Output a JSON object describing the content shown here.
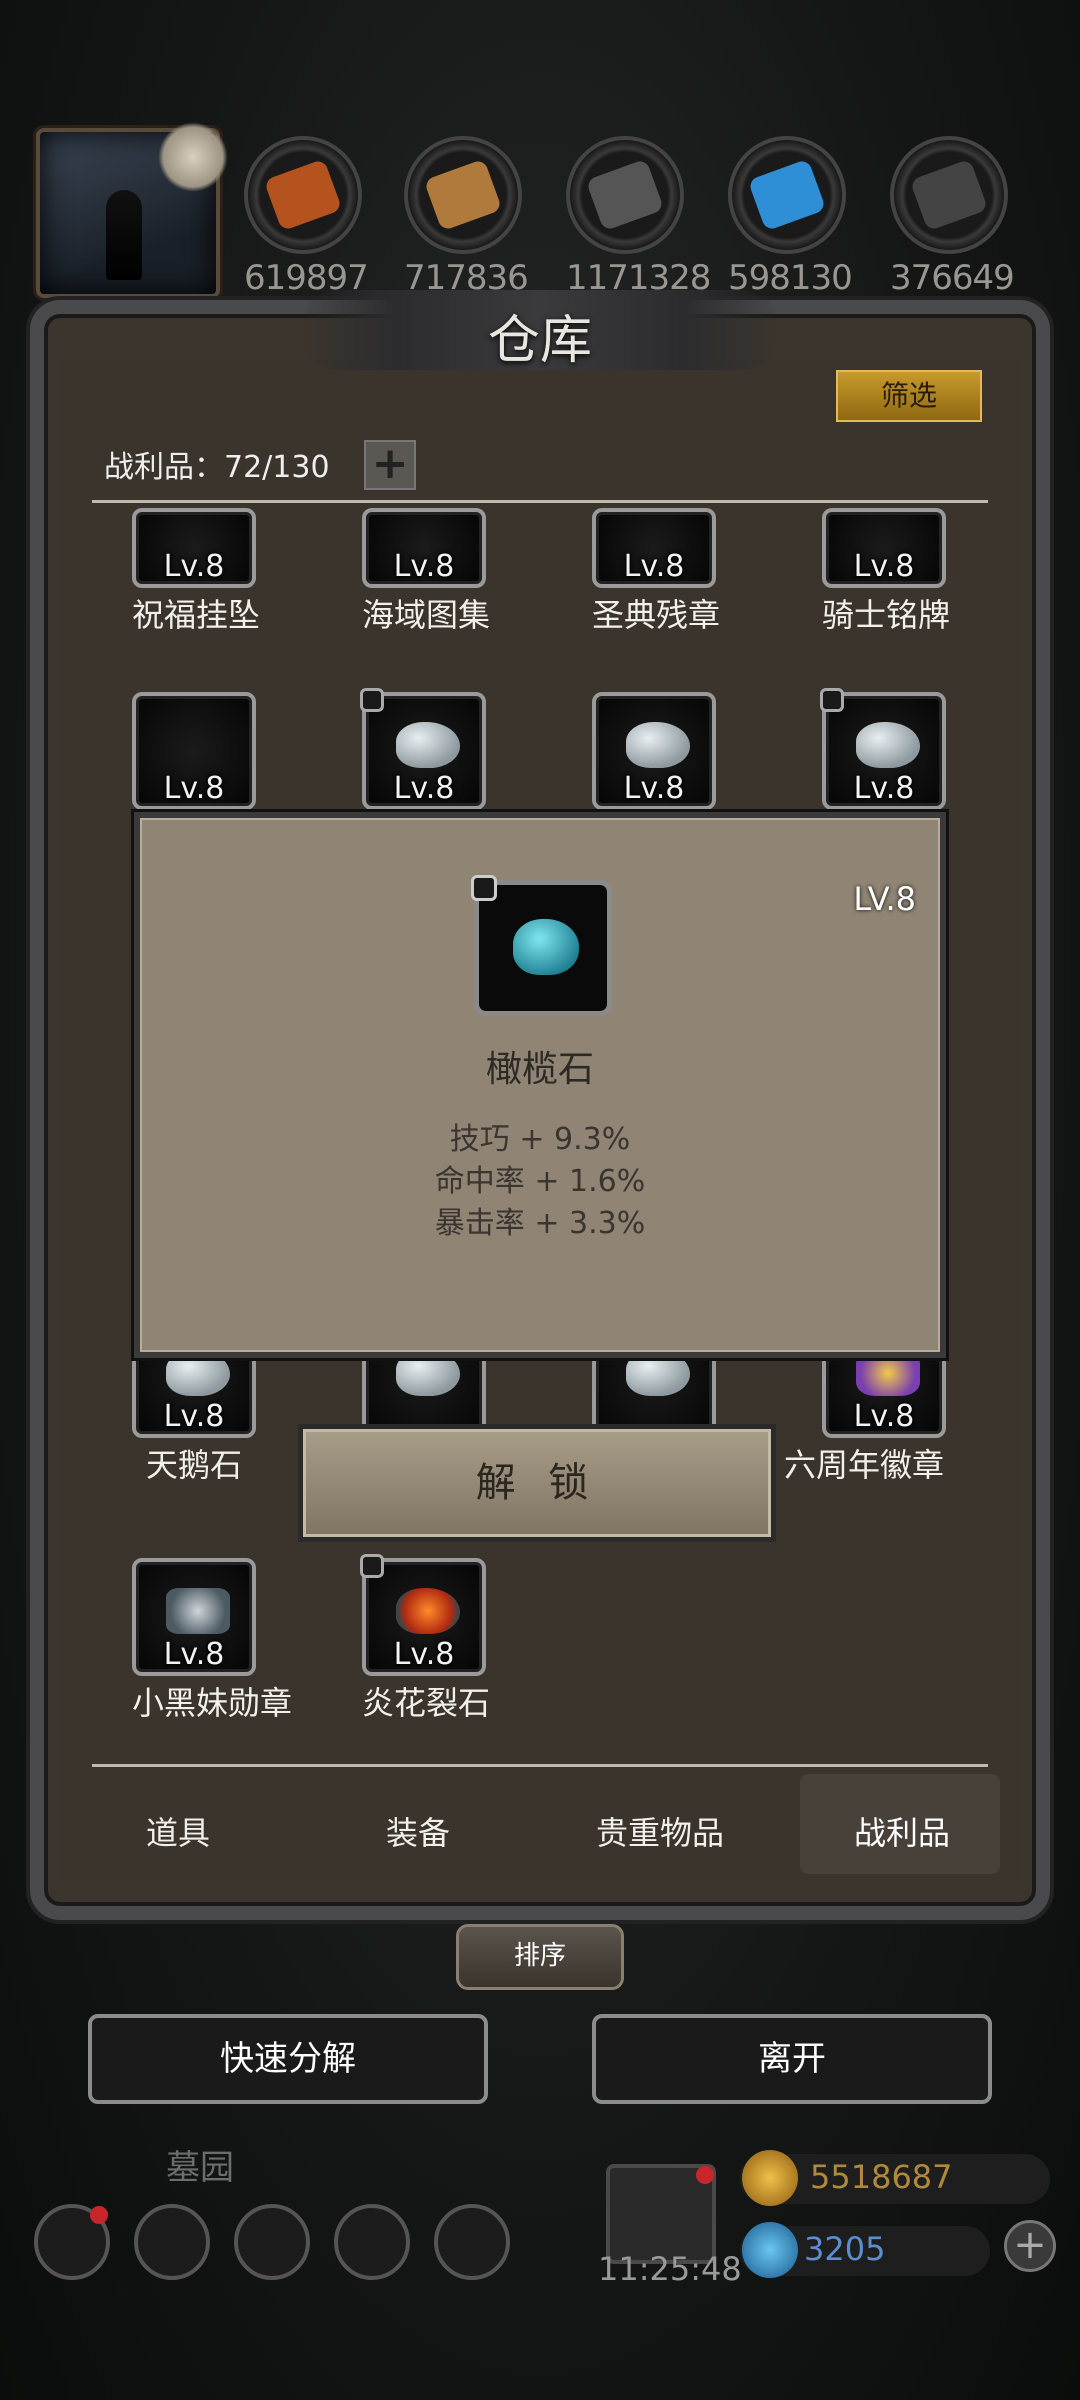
{
  "resources": [
    {
      "name": "wood-log",
      "value": "619897",
      "color": "#b5531f"
    },
    {
      "name": "plank",
      "value": "717836",
      "color": "#b07a3c"
    },
    {
      "name": "iron-ingot",
      "value": "1171328",
      "color": "#555555"
    },
    {
      "name": "crystal",
      "value": "598130",
      "color": "#2f8fd6"
    },
    {
      "name": "steel",
      "value": "376649",
      "color": "#444444"
    }
  ],
  "panel": {
    "title": "仓库",
    "filter_label": "筛选",
    "count_label": "战利品：72/130",
    "add_symbol": "+"
  },
  "items": [
    {
      "name": "祝福挂坠",
      "level": "Lv.8",
      "icon": "pendant-icon",
      "locked": false
    },
    {
      "name": "海域图集",
      "level": "Lv.8",
      "icon": "book-icon",
      "locked": false
    },
    {
      "name": "圣典残章",
      "level": "Lv.8",
      "icon": "book-icon",
      "locked": false
    },
    {
      "name": "骑士铭牌",
      "level": "Lv.8",
      "icon": "badge-icon",
      "locked": false
    },
    {
      "name": "",
      "level": "Lv.8",
      "icon": "badge-icon",
      "locked": false
    },
    {
      "name": "",
      "level": "Lv.8",
      "icon": "stone-icon",
      "locked": true
    },
    {
      "name": "",
      "level": "Lv.8",
      "icon": "stone-icon",
      "locked": false
    },
    {
      "name": "",
      "level": "Lv.8",
      "icon": "stone-icon",
      "locked": true
    },
    {
      "name": "天鹅石",
      "level": "Lv.8",
      "icon": "stone-icon",
      "locked": false
    },
    {
      "name": "",
      "level": "",
      "icon": "stone-icon",
      "locked": false
    },
    {
      "name": "",
      "level": "",
      "icon": "stone-icon",
      "locked": false
    },
    {
      "name": "六周年徽章",
      "level": "Lv.8",
      "icon": "emblem-icon",
      "locked": false
    },
    {
      "name": "小黑妹勋章",
      "level": "Lv.8",
      "icon": "crystal-icon",
      "locked": false
    },
    {
      "name": "炎花裂石",
      "level": "Lv.8",
      "icon": "fire-stone-icon",
      "locked": true
    }
  ],
  "popup": {
    "level": "LV.8",
    "item_name": "橄榄石",
    "stats": [
      "技巧 + 9.3%",
      "命中率 + 1.6%",
      "暴击率 + 3.3%"
    ],
    "unlock_label": "解 锁"
  },
  "tabs": [
    {
      "label": "道具",
      "active": false
    },
    {
      "label": "装备",
      "active": false
    },
    {
      "label": "贵重物品",
      "active": false
    },
    {
      "label": "战利品",
      "active": true
    }
  ],
  "sort_label": "排序",
  "actions": {
    "quick_disassemble": "快速分解",
    "leave": "离开"
  },
  "hud": {
    "location": "墓园",
    "time": "11:25:48",
    "gold": "5518687",
    "gems": "3205",
    "add_symbol": "+"
  }
}
